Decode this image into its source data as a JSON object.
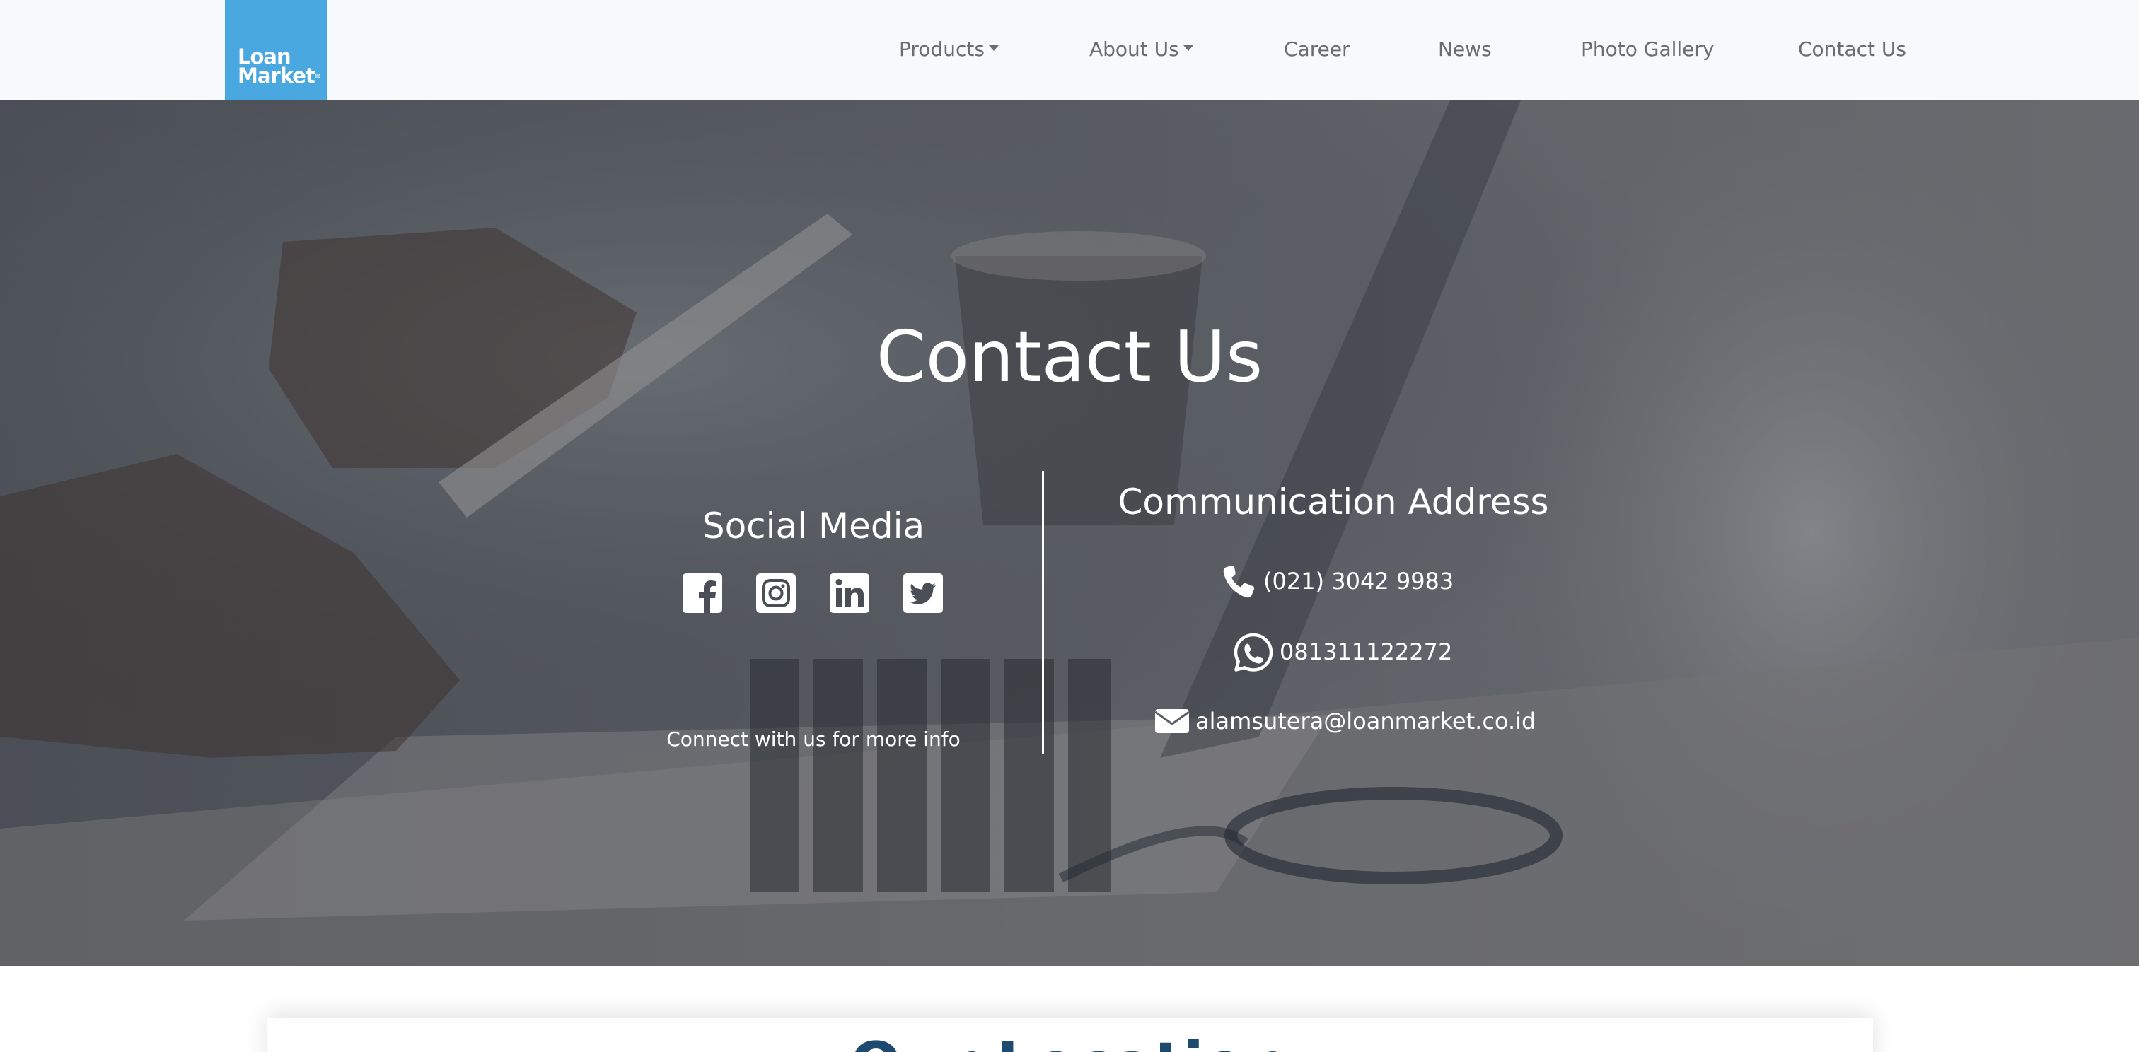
{
  "brand": {
    "logo_line1": "Loan",
    "logo_line2": "Market",
    "trademark": "®"
  },
  "nav": {
    "items": [
      {
        "label": "Products"
      },
      {
        "label": "About Us"
      },
      {
        "label": "Career"
      },
      {
        "label": "News"
      },
      {
        "label": "Photo Gallery"
      },
      {
        "label": "Contact Us"
      }
    ]
  },
  "hero": {
    "title": "Contact Us",
    "social": {
      "heading": "Social Media",
      "icons": [
        "facebook-icon",
        "instagram-icon",
        "linkedin-icon",
        "twitter-icon"
      ],
      "caption": "Connect with us for more info"
    },
    "communication": {
      "heading": "Communication Address",
      "phone": "(021) 3042 9983",
      "whatsapp": "081311122272",
      "email": "alamsutera@loanmarket.co.id"
    }
  },
  "bottom": {
    "heading": "Our Location"
  },
  "colors": {
    "brand_blue": "#4aa8e0",
    "nav_text": "#6c6c72",
    "navbar_bg": "#f8f9fa",
    "heading_blue": "#1d4a6e"
  }
}
